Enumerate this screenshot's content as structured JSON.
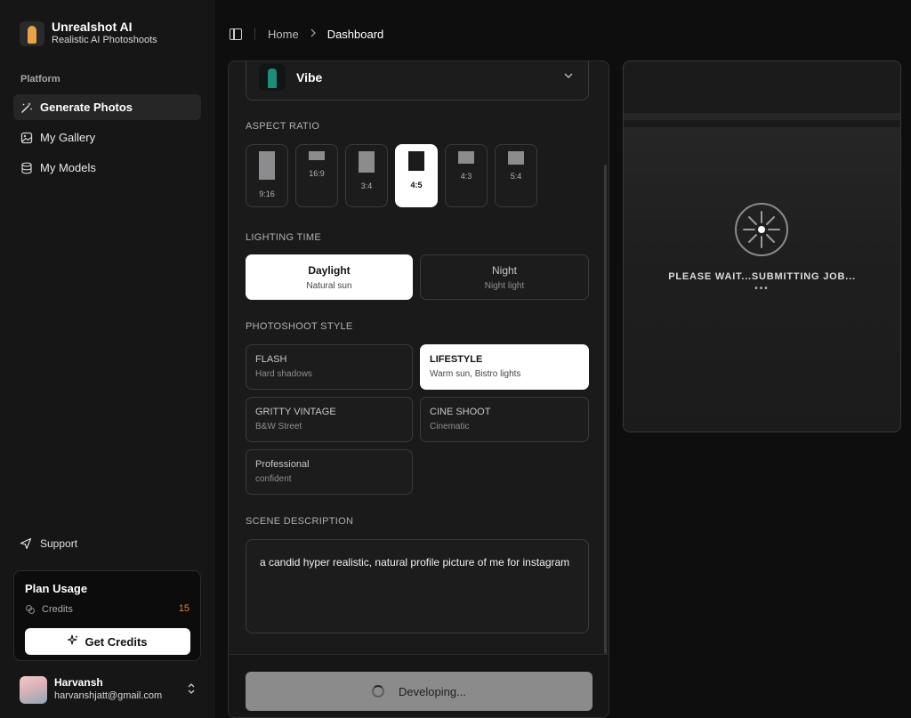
{
  "app": {
    "name": "Unrealshot AI",
    "tagline": "Realistic AI Photoshoots"
  },
  "sidebar": {
    "section_label": "Platform",
    "items": [
      {
        "label": "Generate Photos",
        "icon": "wand-icon",
        "active": true
      },
      {
        "label": "My Gallery",
        "icon": "image-icon",
        "active": false
      },
      {
        "label": "My Models",
        "icon": "database-icon",
        "active": false
      }
    ],
    "support_label": "Support",
    "plan": {
      "title": "Plan Usage",
      "credits_label": "Credits",
      "credits_value": "15",
      "button_label": "Get Credits"
    },
    "user": {
      "name": "Harvansh",
      "email": "harvanshjatt@gmail.com"
    }
  },
  "breadcrumb": {
    "home": "Home",
    "current": "Dashboard"
  },
  "form": {
    "vibe_label": "Vibe",
    "aspect_ratio": {
      "label": "ASPECT RATIO",
      "options": [
        "9:16",
        "16:9",
        "3:4",
        "4:5",
        "4:3",
        "5:4"
      ],
      "selected": "4:5"
    },
    "lighting": {
      "label": "LIGHTING TIME",
      "options": [
        {
          "title": "Daylight",
          "subtitle": "Natural sun",
          "active": true
        },
        {
          "title": "Night",
          "subtitle": "Night light",
          "active": false
        }
      ]
    },
    "style": {
      "label": "PHOTOSHOOT STYLE",
      "options": [
        {
          "title": "FLASH",
          "subtitle": "Hard shadows",
          "active": false
        },
        {
          "title": "LIFESTYLE",
          "subtitle": "Warm sun, Bistro lights",
          "active": true
        },
        {
          "title": "GRITTY VINTAGE",
          "subtitle": "B&W Street",
          "active": false
        },
        {
          "title": "CINE SHOOT",
          "subtitle": "Cinematic",
          "active": false
        },
        {
          "title": "Professional",
          "subtitle": "confident",
          "active": false
        }
      ]
    },
    "scene": {
      "label": "SCENE DESCRIPTION",
      "value": "a candid hyper realistic, natural profile picture of me for instagram"
    },
    "submit_label": "Developing..."
  },
  "preview": {
    "status": "PLEASE WAIT...SUBMITTING JOB...",
    "dots": "•••"
  }
}
